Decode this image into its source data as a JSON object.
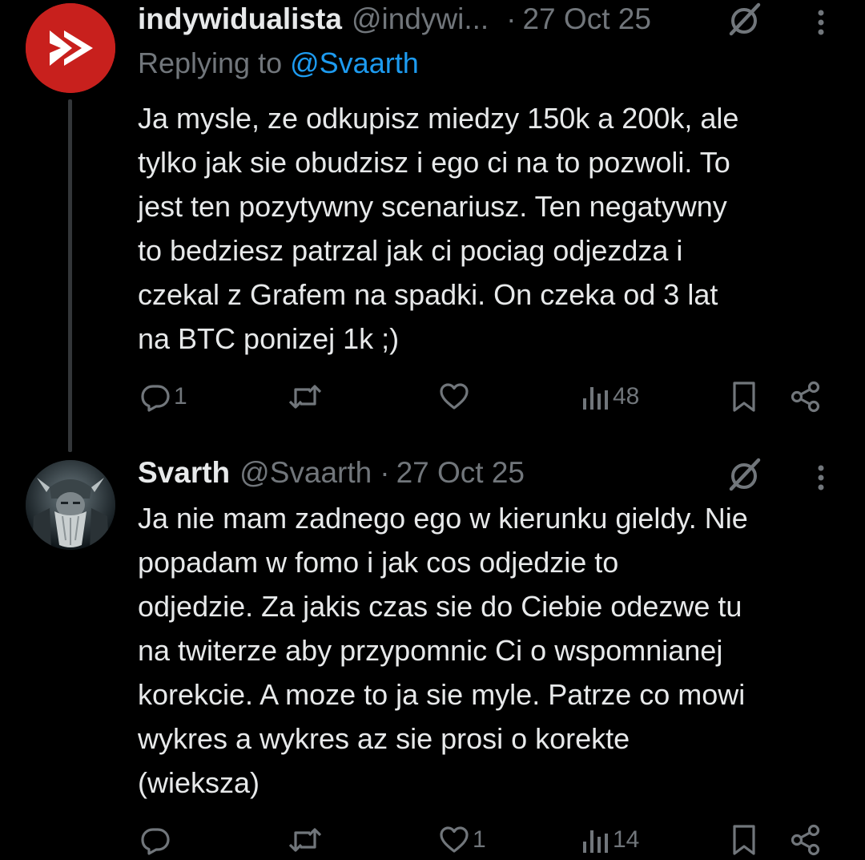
{
  "tweets": [
    {
      "display_name": "indywidualista",
      "handle": "@indywi...",
      "separator": "·",
      "date": "27 Oct 25",
      "replying_prefix": "Replying to",
      "replying_to": "@Svaarth",
      "avatar_icon": "red-logo-avatar",
      "text": "Ja mysle, ze odkupisz miedzy 150k a 200k, ale\ntylko jak sie obudzisz i ego ci na to pozwoli. To\njest ten pozytywny scenariusz. Ten negatywny\nto bedziesz patrzal jak ci pociag odjezdza i\nczekal z Grafem na spadki. On czeka od 3 lat\nna BTC ponizej 1k ;)",
      "stats": {
        "replies": "1",
        "reposts": "",
        "likes": "",
        "views": "48"
      }
    },
    {
      "display_name": "Svarth",
      "handle": "@Svaarth",
      "separator": "·",
      "date": "27 Oct 25",
      "avatar_icon": "viking-portrait-avatar",
      "text": "Ja nie mam zadnego ego w kierunku gieldy. Nie\npopadam w fomo i jak cos odjedzie to\nodjedzie. Za jakis czas sie do Ciebie odezwe tu\nna twiterze aby przypomnic Ci o wspomnianej\nkorekcie. A moze to ja sie myle. Patrze co mowi\nwykres a wykres az sie prosi o korekte\n(wieksza)",
      "stats": {
        "replies": "",
        "reposts": "",
        "likes": "1",
        "views": "14"
      }
    }
  ],
  "icons": {
    "reply": "reply-icon",
    "repost": "repost-icon",
    "like": "like-icon",
    "views": "views-icon",
    "bookmark": "bookmark-icon",
    "share": "share-icon",
    "grok": "grok-icon",
    "more": "more-icon"
  },
  "colors": {
    "background": "#000000",
    "text": "#e7e9ea",
    "secondary": "#71767b",
    "link": "#1d9bf0",
    "avatar_red": "#c8201d"
  }
}
